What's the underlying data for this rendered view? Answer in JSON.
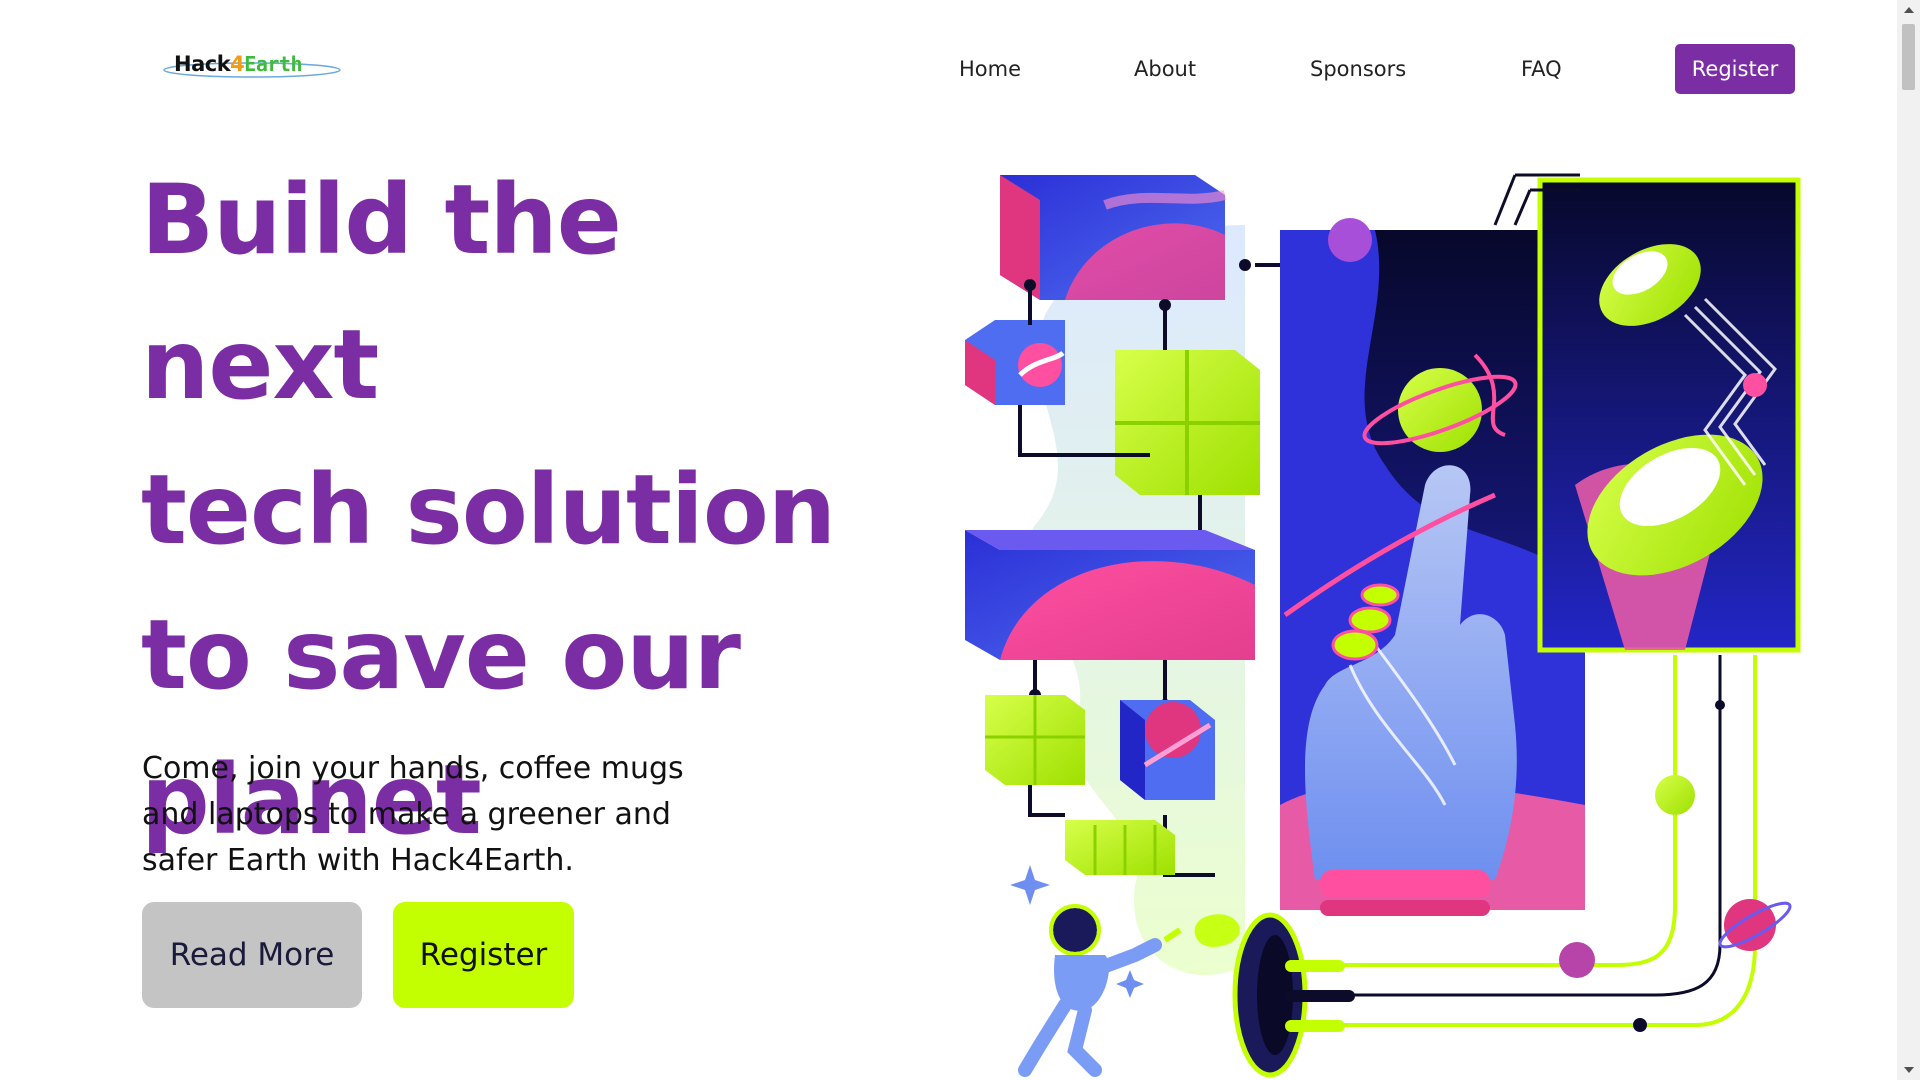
{
  "brand": {
    "logo_part1": "Hack",
    "logo_part2": "4",
    "logo_part3": "Earth",
    "primary_color": "#7b2ea3",
    "accent_color": "#c3ff00"
  },
  "nav": {
    "items": [
      {
        "label": "Home"
      },
      {
        "label": "About"
      },
      {
        "label": "Sponsors"
      },
      {
        "label": "FAQ"
      }
    ],
    "register_label": "Register"
  },
  "hero": {
    "title_lines": [
      "Build the next",
      "tech solution",
      "to save our",
      "planet"
    ],
    "subtitle_lines": [
      "Come, join your hands, coffee mugs",
      "and laptops to make a greener and",
      "safer Earth with Hack4Earth."
    ],
    "read_more_label": "Read More",
    "register_label": "Register"
  },
  "illustration": {
    "icon": "space-hands-planets-illustration"
  },
  "scrollbar": {
    "up_icon": "scroll-up-arrow-icon",
    "down_icon": "scroll-down-arrow-icon"
  }
}
